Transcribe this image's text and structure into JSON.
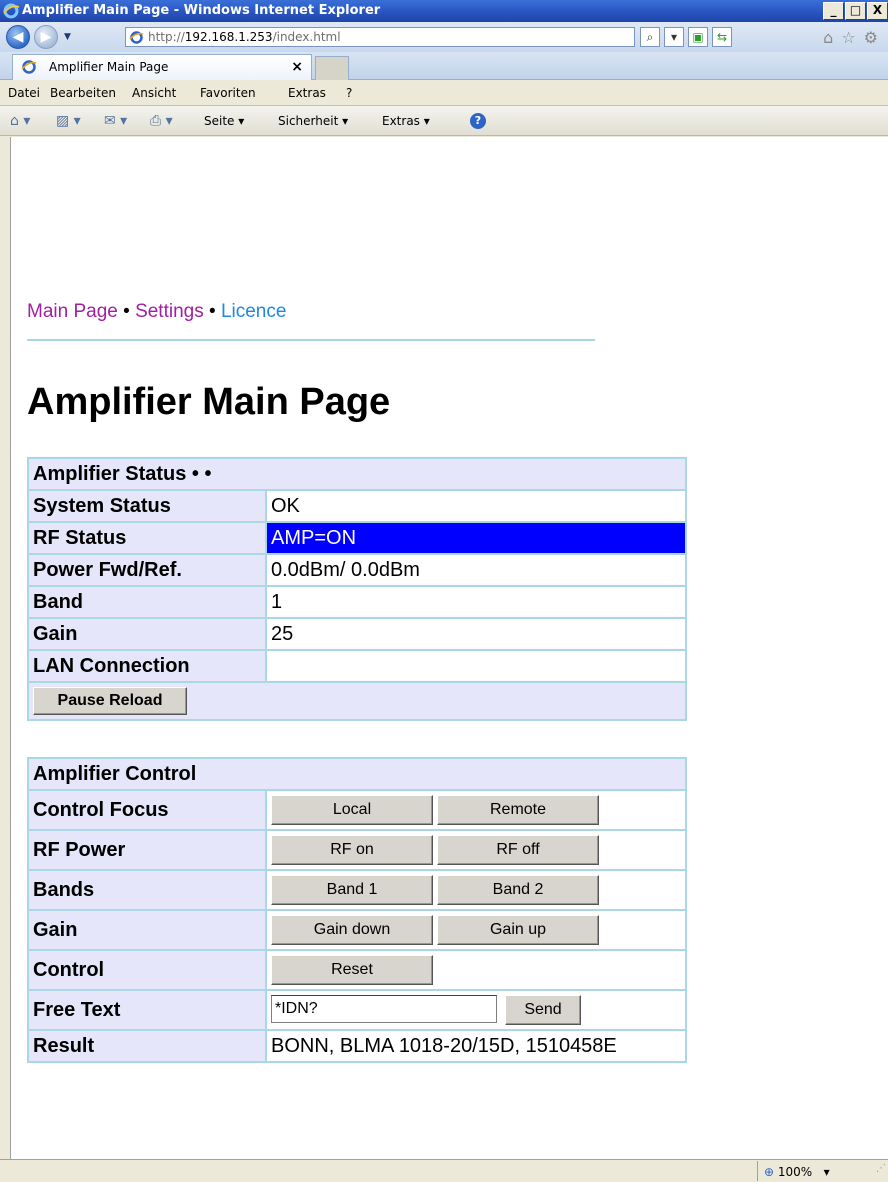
{
  "window": {
    "title": "Amplifier Main Page - Windows Internet Explorer",
    "minimize": "_",
    "maximize": "□",
    "close": "X"
  },
  "address": {
    "prefix": "http://",
    "host": "192.168.1.253",
    "path": "/index.html"
  },
  "tab": {
    "label": "Amplifier Main Page",
    "close": "×"
  },
  "menu": [
    "Datei",
    "Bearbeiten",
    "Ansicht",
    "Favoriten",
    "Extras",
    "?"
  ],
  "commandbar": {
    "page": "Seite ▾",
    "security": "Sicherheit ▾",
    "tools": "Extras ▾"
  },
  "nav": {
    "main": "Main Page",
    "settings": "Settings",
    "licence": "Licence",
    "sep": "•"
  },
  "page_title": "Amplifier Main Page",
  "status": {
    "header": "Amplifier Status  • •",
    "rows": [
      {
        "label": "System Status",
        "value": "OK"
      },
      {
        "label": "RF Status",
        "value": "AMP=ON"
      },
      {
        "label": "Power Fwd/Ref.",
        "value": "0.0dBm/ 0.0dBm"
      },
      {
        "label": "Band",
        "value": "1"
      },
      {
        "label": "Gain",
        "value": "25"
      },
      {
        "label": "LAN Connection",
        "value": ""
      }
    ],
    "pause_button": "Pause Reload"
  },
  "control": {
    "header": "Amplifier Control",
    "control_focus": {
      "label": "Control Focus",
      "local": "Local",
      "remote": "Remote"
    },
    "rf_power": {
      "label": "RF Power",
      "on": "RF on",
      "off": "RF off"
    },
    "bands": {
      "label": "Bands",
      "band1": "Band 1",
      "band2": "Band 2"
    },
    "gain": {
      "label": "Gain",
      "down": "Gain down",
      "up": "Gain up"
    },
    "control": {
      "label": "Control",
      "reset": "Reset"
    },
    "free_text": {
      "label": "Free Text",
      "value": "*IDN?",
      "send": "Send"
    },
    "result": {
      "label": "Result",
      "value": "BONN, BLMA 1018-20/15D, 1510458E"
    }
  },
  "statusbar": {
    "zoom": "100%"
  },
  "colors": {
    "rf_highlight": "#0000ff",
    "table_border": "#a9d7e3",
    "label_bg": "#e6e6fa"
  }
}
